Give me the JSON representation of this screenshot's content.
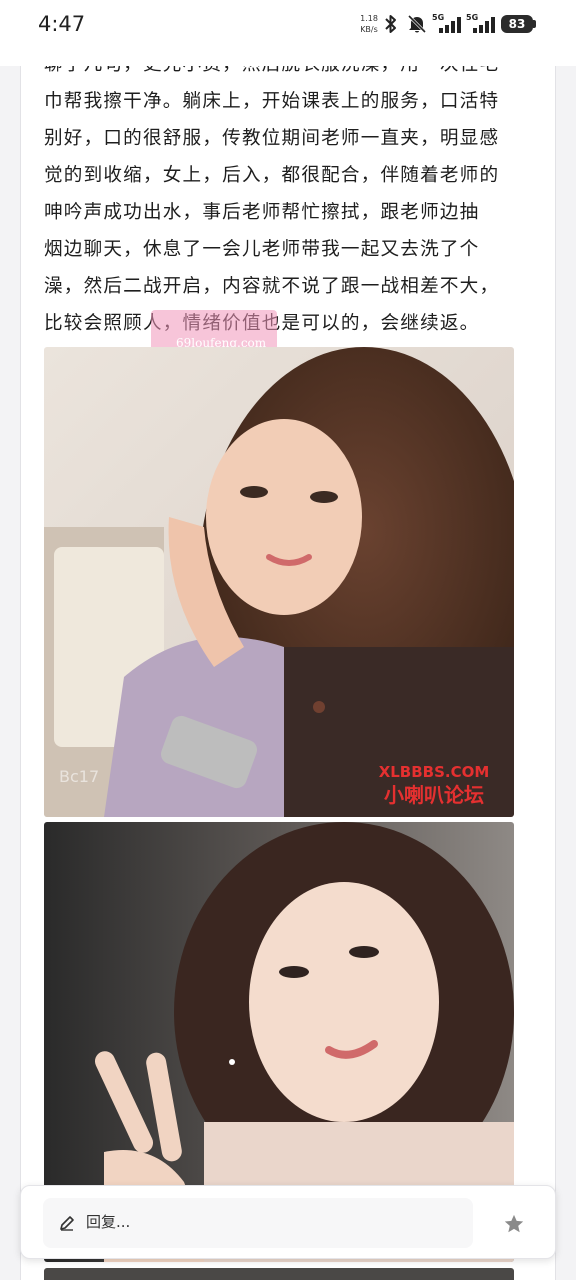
{
  "status_bar": {
    "time": "4:47",
    "net_speed_value": "1.18",
    "net_speed_unit": "KB/s",
    "signal_1_label": "5G",
    "signal_2_label": "5G",
    "battery_level": "83",
    "icons": [
      "bluetooth-icon",
      "mute-icon",
      "signal-icon",
      "battery-icon"
    ]
  },
  "post": {
    "text_lines": [
      "聊了几句，更先小费，然后脱衣服洗澡，用一次性毛",
      "巾帮我擦干净。躺床上，开始课表上的服务，口活特",
      "别好，口的很舒服，传教位期间老师一直夹，明显感",
      "觉的到收缩，女上，后入，都很配合，伴随着老师的",
      "呻吟声成功出水，事后老师帮忙擦拭，跟老师边抽",
      "烟边聊天，休息了一会儿老师带我一起又去洗了个",
      "澡，然后二战开启，内容就不说了跟一战相差不大，",
      "比较会照顾人，情绪价值也是可以的，会继续返。"
    ],
    "watermark": "69loufeng.com",
    "photo1_watermark": "XLBBBS.COM",
    "photo1_watermark_cn": "小喇叭论坛",
    "photo1_corner_text": "Bc17"
  },
  "reply_bar": {
    "label": "回复...",
    "icons": [
      "pencil-icon",
      "star-icon"
    ]
  },
  "colors": {
    "accent_watermark": "#f096b9",
    "forum_watermark": "#e53030",
    "text": "#1e1e1e"
  }
}
